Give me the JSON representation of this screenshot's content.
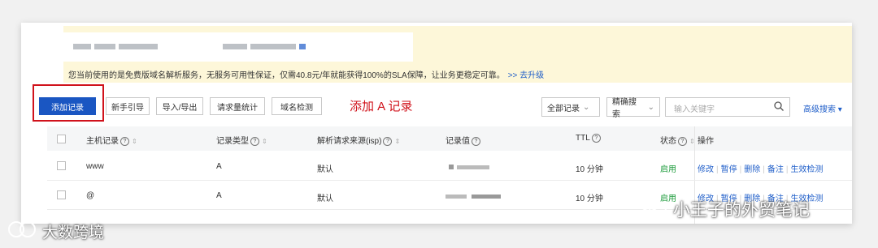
{
  "notice": {
    "text": "您当前使用的是免费版域名解析服务，无服务可用性保证，仅需40.8元/年就能获得100%的SLA保障，让业务更稳定可靠。",
    "upgrade_link": ">> 去升级"
  },
  "toolbar": {
    "add_record": "添加记录",
    "beginner_guide": "新手引导",
    "import_export": "导入/导出",
    "request_stats": "请求量统计",
    "domain_check": "域名检测",
    "annotation": "添加 A 记录",
    "filter_select": "全部记录",
    "search_mode": "精确搜索",
    "search_placeholder": "输入关键字",
    "advanced_search": "高级搜索"
  },
  "table": {
    "columns": {
      "host": "主机记录",
      "type": "记录类型",
      "isp": "解析请求来源(isp)",
      "value": "记录值",
      "ttl": "TTL",
      "status": "状态",
      "actions": "操作"
    },
    "rows": [
      {
        "host": "www",
        "type": "A",
        "isp": "默认",
        "ttl": "10 分钟",
        "status": "启用"
      },
      {
        "host": "@",
        "type": "A",
        "isp": "默认",
        "ttl": "10 分钟",
        "status": "启用"
      }
    ],
    "actions": [
      "修改",
      "暂停",
      "删除",
      "备注",
      "生效检测"
    ]
  },
  "watermarks": {
    "wechat": "小王子的外贸笔记",
    "brand": "大数跨境"
  },
  "colors": {
    "primary": "#1a56c2",
    "annotation_red": "#d0121b",
    "notice_bg": "#fdf7d9",
    "link": "#1f5ec9",
    "status_green": "#1a9a39"
  }
}
